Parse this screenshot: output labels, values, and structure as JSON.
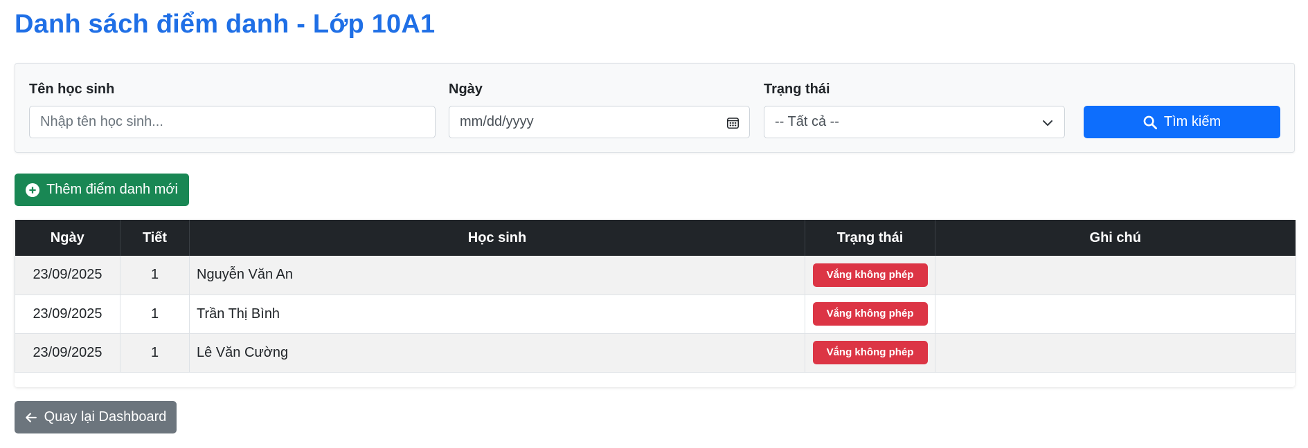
{
  "page": {
    "title": "Danh sách điểm danh - Lớp 10A1"
  },
  "filters": {
    "student_name": {
      "label": "Tên học sinh",
      "placeholder": "Nhập tên học sinh..."
    },
    "date": {
      "label": "Ngày",
      "value": "mm/dd/yyyy",
      "icon": "calendar-icon"
    },
    "status": {
      "label": "Trạng thái",
      "selected": "-- Tất cả --",
      "icon": "chevron-down-icon"
    },
    "search_button": {
      "label": "Tìm kiếm",
      "icon": "search-icon"
    }
  },
  "actions": {
    "add_button": {
      "label": "Thêm điểm danh mới",
      "icon": "plus-circle-icon"
    },
    "back_button": {
      "label": "Quay lại Dashboard",
      "icon": "arrow-left-icon"
    }
  },
  "table": {
    "columns": [
      "Ngày",
      "Tiết",
      "Học sinh",
      "Trạng thái",
      "Ghi chú"
    ],
    "rows": [
      {
        "date": "23/09/2025",
        "period": "1",
        "student": "Nguyễn Văn An",
        "status": "Vắng không phép",
        "note": ""
      },
      {
        "date": "23/09/2025",
        "period": "1",
        "student": "Trần Thị Bình",
        "status": "Vắng không phép",
        "note": ""
      },
      {
        "date": "23/09/2025",
        "period": "1",
        "student": "Lê Văn Cường",
        "status": "Vắng không phép",
        "note": ""
      }
    ]
  },
  "colors": {
    "title": "#1f6fe6",
    "primary": "#0d6efd",
    "success": "#198754",
    "danger": "#dc3545",
    "secondary": "#6c757d",
    "table_header": "#212529"
  }
}
